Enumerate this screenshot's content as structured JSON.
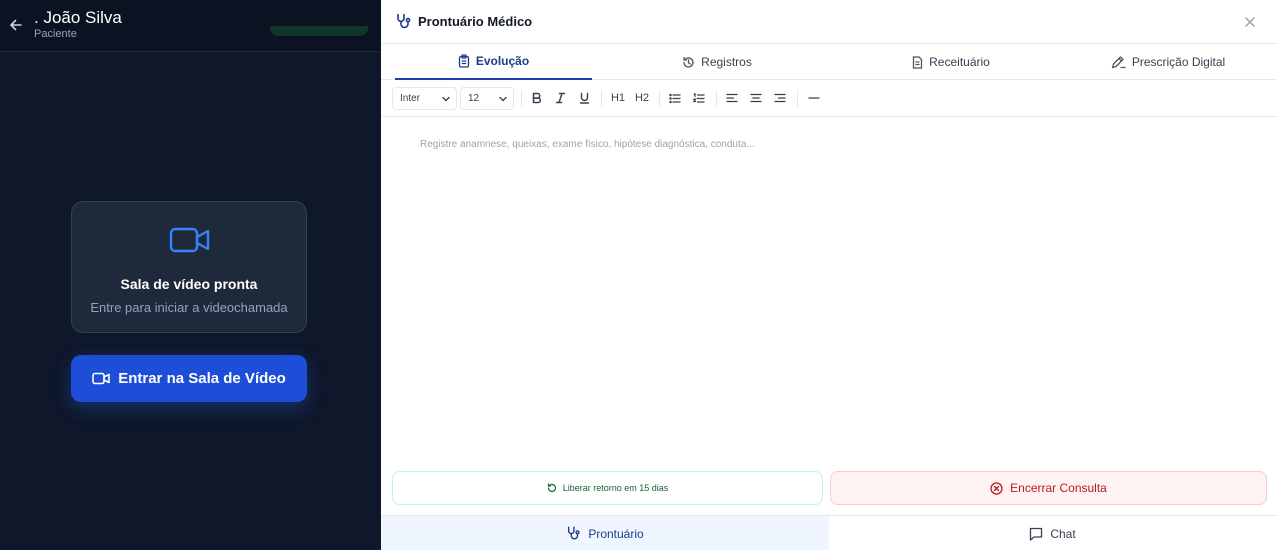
{
  "patient": {
    "name": ". João Silva",
    "role": "Paciente"
  },
  "video_card": {
    "title": "Sala de vídeo pronta",
    "subtitle": "Entre para iniciar a videochamada"
  },
  "enter_button": {
    "label": "Entrar na Sala de Vídeo"
  },
  "record_panel": {
    "title": "Prontuário Médico",
    "tabs": [
      {
        "label": "Evolução",
        "icon": "clipboard-icon",
        "active": true
      },
      {
        "label": "Registros",
        "icon": "history-icon",
        "active": false
      },
      {
        "label": "Receituário",
        "icon": "file-text-icon",
        "active": false
      },
      {
        "label": "Prescrição Digital",
        "icon": "pen-icon",
        "active": false
      }
    ],
    "toolbar": {
      "font_family": "Inter",
      "font_size": "12",
      "h1": "H1",
      "h2": "H2"
    },
    "editor_placeholder": "Registre anamnese, queixas, exame físico, hipótese diagnóstica, conduta...",
    "return_button": "Liberar retorno em 15 dias",
    "end_button": "Encerrar Consulta",
    "bottom_tabs": [
      {
        "label": "Prontuário",
        "icon": "stethoscope-icon",
        "active": true
      },
      {
        "label": "Chat",
        "icon": "chat-icon",
        "active": false
      }
    ]
  },
  "colors": {
    "left_bg": "#0f172a",
    "card_bg": "#1e293b",
    "primary": "#1d4ed8",
    "accent_icon": "#3b82f6",
    "active_tab": "#1e3a8a",
    "danger": "#b91c1c",
    "success": "#166534"
  }
}
